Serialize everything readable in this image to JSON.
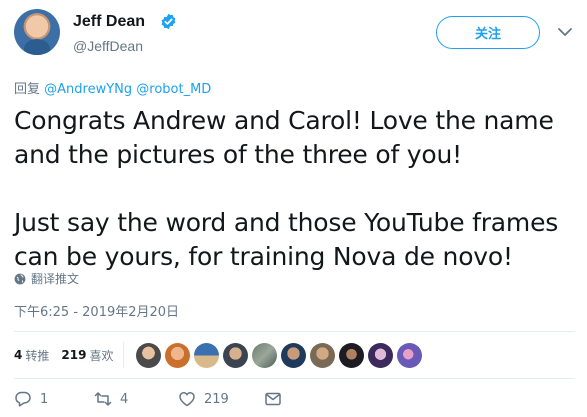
{
  "user": {
    "name": "Jeff Dean",
    "handle": "@JeffDean",
    "follow_label": "关注"
  },
  "reply": {
    "prefix": "回复 ",
    "mentions": "@AndrewYNg @robot_MD"
  },
  "tweet": {
    "paragraph1": "Congrats Andrew and Carol!  Love the name and the pictures of the three of you!",
    "paragraph2": "Just say the word and those YouTube frames can be yours, for training Nova de novo!"
  },
  "translate_label": "翻译推文",
  "timestamp": "下午6:25 - 2019年2月20日",
  "stats": {
    "retweets": "4",
    "retweets_label": "转推",
    "likes": "219",
    "likes_label": "喜欢"
  },
  "actions": {
    "reply_count": "1",
    "retweet_count": "4",
    "like_count": "219"
  },
  "colors": {
    "accent": "#1da1f2",
    "muted": "#657786",
    "text": "#14171a"
  },
  "icons": [
    "verified-badge-icon",
    "chevron-down-icon",
    "globe-icon",
    "reply-icon",
    "retweet-icon",
    "heart-icon",
    "direct-message-icon"
  ]
}
